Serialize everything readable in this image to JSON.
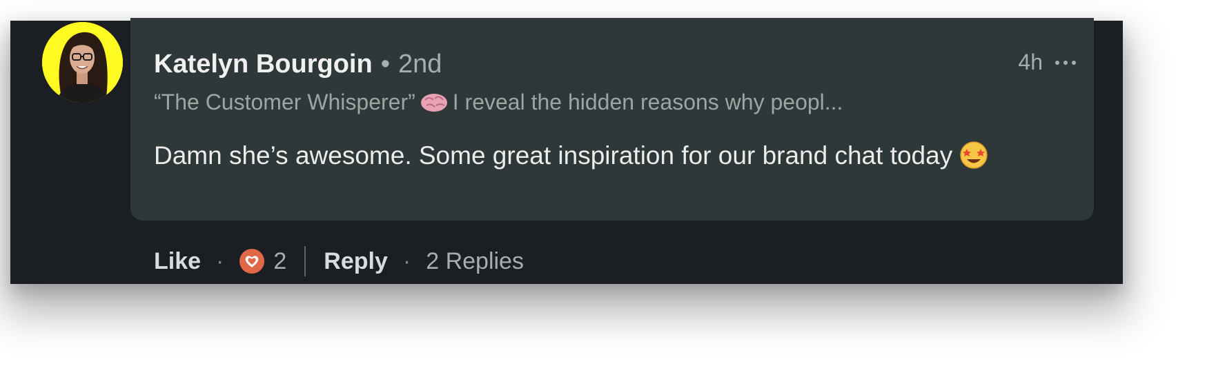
{
  "comment": {
    "author_name": "Katelyn Bourgoin",
    "separator": "•",
    "connection_degree": "2nd",
    "time": "4h",
    "headline_prefix": "“The Customer Whisperer”",
    "headline_rest": "I reveal the hidden reasons why peopl...",
    "body_text": "Damn she’s awesome. Some great inspiration for our brand chat today",
    "avatar_bg_color": "#fffb22",
    "bubble_color": "#2f3838",
    "background_color": "#1b1f23"
  },
  "actions": {
    "like_label": "Like",
    "reaction_count": "2",
    "reply_label": "Reply",
    "replies_label": "2 Replies",
    "dot": "·"
  },
  "icons": [
    "brain-emoji",
    "star-struck-emoji",
    "love-reaction-icon",
    "more-options-icon"
  ]
}
